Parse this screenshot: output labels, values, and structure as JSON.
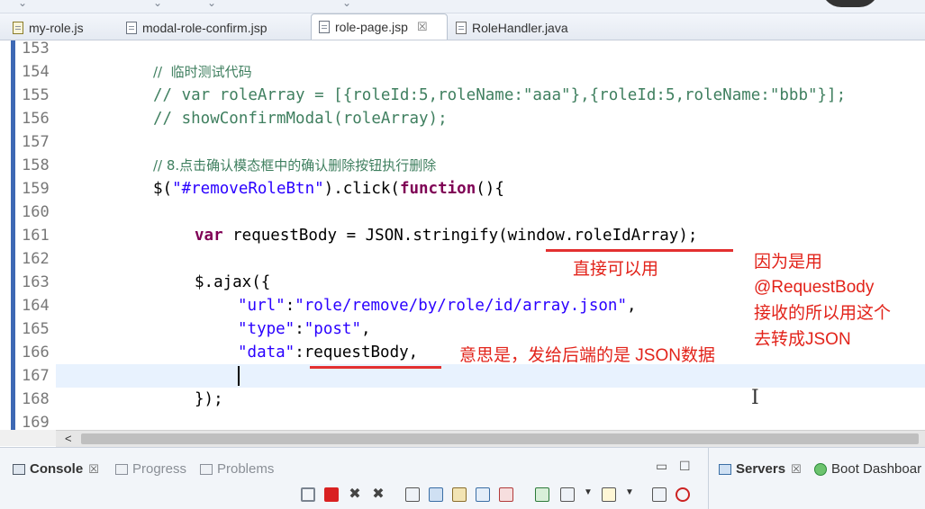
{
  "editor_tabs": [
    {
      "label": "my-role.js",
      "icon": "js-file-icon",
      "active": false
    },
    {
      "label": "modal-role-confirm.jsp",
      "icon": "jsp-file-icon",
      "active": false
    },
    {
      "label": "role-page.jsp",
      "icon": "jsp-file-icon",
      "active": true,
      "close": "☒"
    },
    {
      "label": "RoleHandler.java",
      "icon": "java-file-icon",
      "active": false
    }
  ],
  "line_numbers": [
    "153",
    "154",
    "155",
    "156",
    "157",
    "158",
    "159",
    "160",
    "161",
    "162",
    "163",
    "164",
    "165",
    "166",
    "167",
    "168",
    "169"
  ],
  "code": {
    "l154": "//  临时测试代码",
    "l155": "// var roleArray = [{roleId:5,roleName:\"aaa\"},{roleId:5,roleName:\"bbb\"}];",
    "l156": "// showConfirmModal(roleArray);",
    "l158": "// 8.点击确认模态框中的确认删除按钮执行删除",
    "l159a": "$(",
    "l159b": "\"#removeRoleBtn\"",
    "l159c": ").click(",
    "l159d": "function",
    "l159e": "(){",
    "l161a": "var",
    "l161b": " requestBody = JSON.stringify(window.roleIdArray);",
    "l163": "$.ajax({",
    "l164a": "\"url\"",
    "l164b": ":",
    "l164c": "\"role/remove/by/role/id/array.json\"",
    "l164d": ",",
    "l165a": "\"type\"",
    "l165b": ":",
    "l165c": "\"post\"",
    "l165d": ",",
    "l166a": "\"data\"",
    "l166b": ":requestBody,",
    "l168": "});"
  },
  "annotations": {
    "note1": "直接可以用",
    "note2_lines": [
      "因为是用",
      "@RequestBody",
      "接收的所以用这个",
      "去转成JSON"
    ],
    "note3": "意思是，发给后端的是 JSON数据"
  },
  "scroll_arrow": "<",
  "bottom_tabs": [
    {
      "label": "Console",
      "close": "☒",
      "dim": false
    },
    {
      "label": "Progress",
      "dim": true
    },
    {
      "label": "Problems",
      "dim": true
    }
  ],
  "right_tabs": [
    {
      "label": "Servers",
      "close": "☒"
    },
    {
      "label": "Boot Dashboar"
    }
  ],
  "colors": {
    "comment": "#3f7f5f",
    "string": "#2a00ff",
    "keyword": "#7f0055",
    "annotation": "#e2231a",
    "ruler": "#3e69b4"
  }
}
